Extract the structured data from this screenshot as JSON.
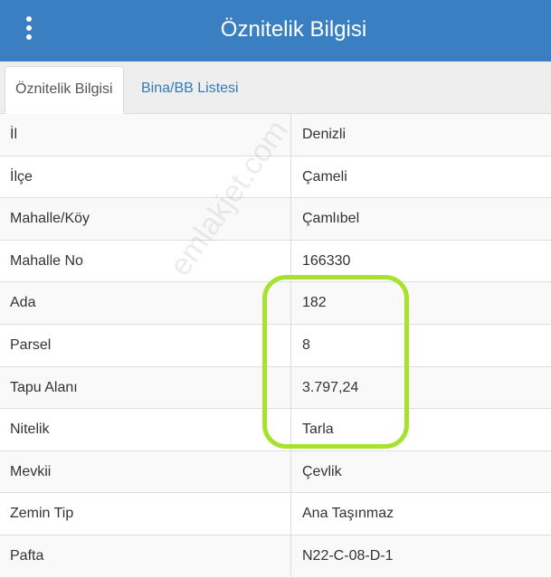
{
  "header": {
    "title": "Öznitelik Bilgisi",
    "menu_icon": "more-vertical-icon"
  },
  "tabs": [
    {
      "label": "Öznitelik Bilgisi",
      "active": true
    },
    {
      "label": "Bina/BB Listesi",
      "active": false
    }
  ],
  "rows": [
    {
      "label": "İl",
      "value": "Denizli"
    },
    {
      "label": "İlçe",
      "value": "Çameli"
    },
    {
      "label": "Mahalle/Köy",
      "value": "Çamlıbel"
    },
    {
      "label": "Mahalle No",
      "value": "166330"
    },
    {
      "label": "Ada",
      "value": "182"
    },
    {
      "label": "Parsel",
      "value": "8"
    },
    {
      "label": "Tapu Alanı",
      "value": "3.797,24"
    },
    {
      "label": "Nitelik",
      "value": "Tarla"
    },
    {
      "label": "Mevkii",
      "value": "Çevlik"
    },
    {
      "label": "Zemin Tip",
      "value": "Ana Taşınmaz"
    },
    {
      "label": "Pafta",
      "value": "N22-C-08-D-1"
    }
  ],
  "watermark": "emlakjet.com",
  "colors": {
    "header_bg": "#3a7fc1",
    "link": "#337ab7",
    "highlight": "#a6e22e"
  }
}
